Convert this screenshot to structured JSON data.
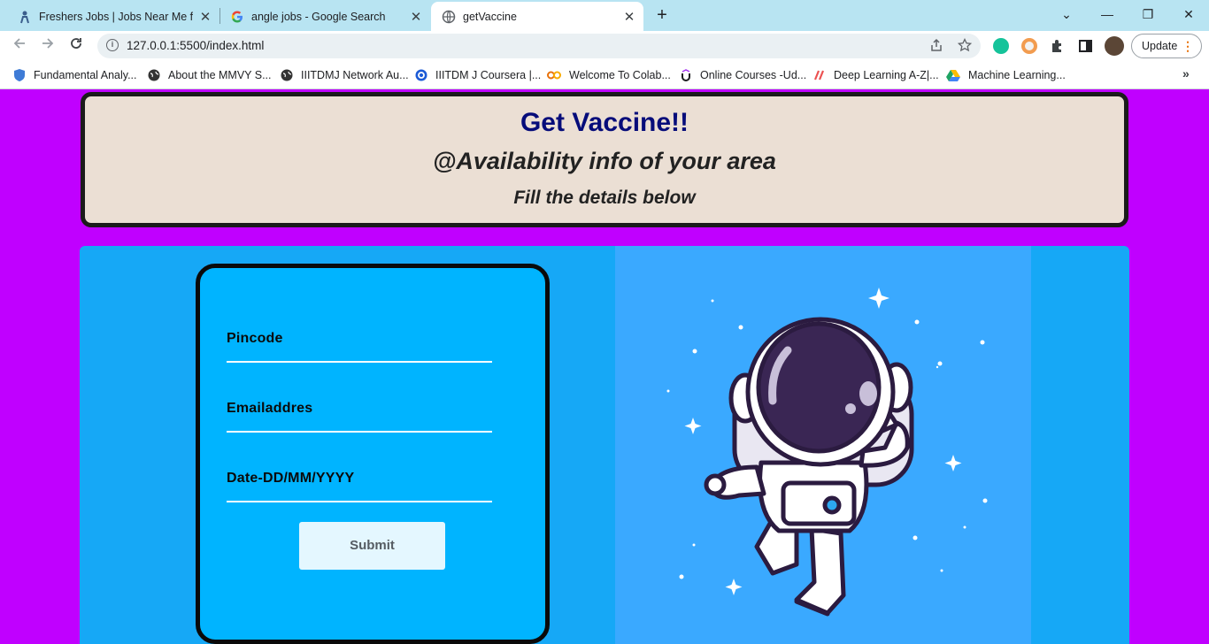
{
  "browser": {
    "tabs": [
      {
        "title": "Freshers Jobs | Jobs Near Me for F",
        "icon": "person-icon",
        "active": false
      },
      {
        "title": "angle jobs - Google Search",
        "icon": "google-icon",
        "active": false
      },
      {
        "title": "getVaccine",
        "icon": "globe-icon",
        "active": true
      }
    ],
    "new_tab": "+",
    "window_controls": {
      "dropdown": "⌄",
      "minimize": "—",
      "restore": "❐",
      "close": "✕"
    },
    "url": "127.0.0.1:5500/index.html",
    "update_label": "Update",
    "bookmarks": [
      {
        "label": "Fundamental Analy...",
        "icon": "shield-icon"
      },
      {
        "label": "About the MMVY S...",
        "icon": "globe-icon"
      },
      {
        "label": "IIITDMJ Network Au...",
        "icon": "globe-icon"
      },
      {
        "label": "IIITDM J Coursera |...",
        "icon": "coursera-icon"
      },
      {
        "label": "Welcome To Colab...",
        "icon": "colab-icon"
      },
      {
        "label": "Online Courses -Ud...",
        "icon": "udemy-icon"
      },
      {
        "label": "Deep Learning A-Z|...",
        "icon": "udemy-logo-icon"
      },
      {
        "label": "Machine Learning...",
        "icon": "drive-icon"
      }
    ],
    "bookmarks_more": "»"
  },
  "header": {
    "title": "Get Vaccine!!",
    "subtitle": "@Availability info of your area",
    "instruction": "Fill the details below"
  },
  "form": {
    "fields": [
      {
        "label": "Pincode"
      },
      {
        "label": "Emailaddres"
      },
      {
        "label": "Date-DD/MM/YYYY"
      }
    ],
    "submit_label": "Submit"
  },
  "colors": {
    "page_background": "#c000ff",
    "header_background": "#ebdfd4",
    "title_color": "#060c7a",
    "panel_background": "#16a8f6",
    "form_background": "#00b4ff",
    "illustration_background": "#3aa9ff"
  }
}
